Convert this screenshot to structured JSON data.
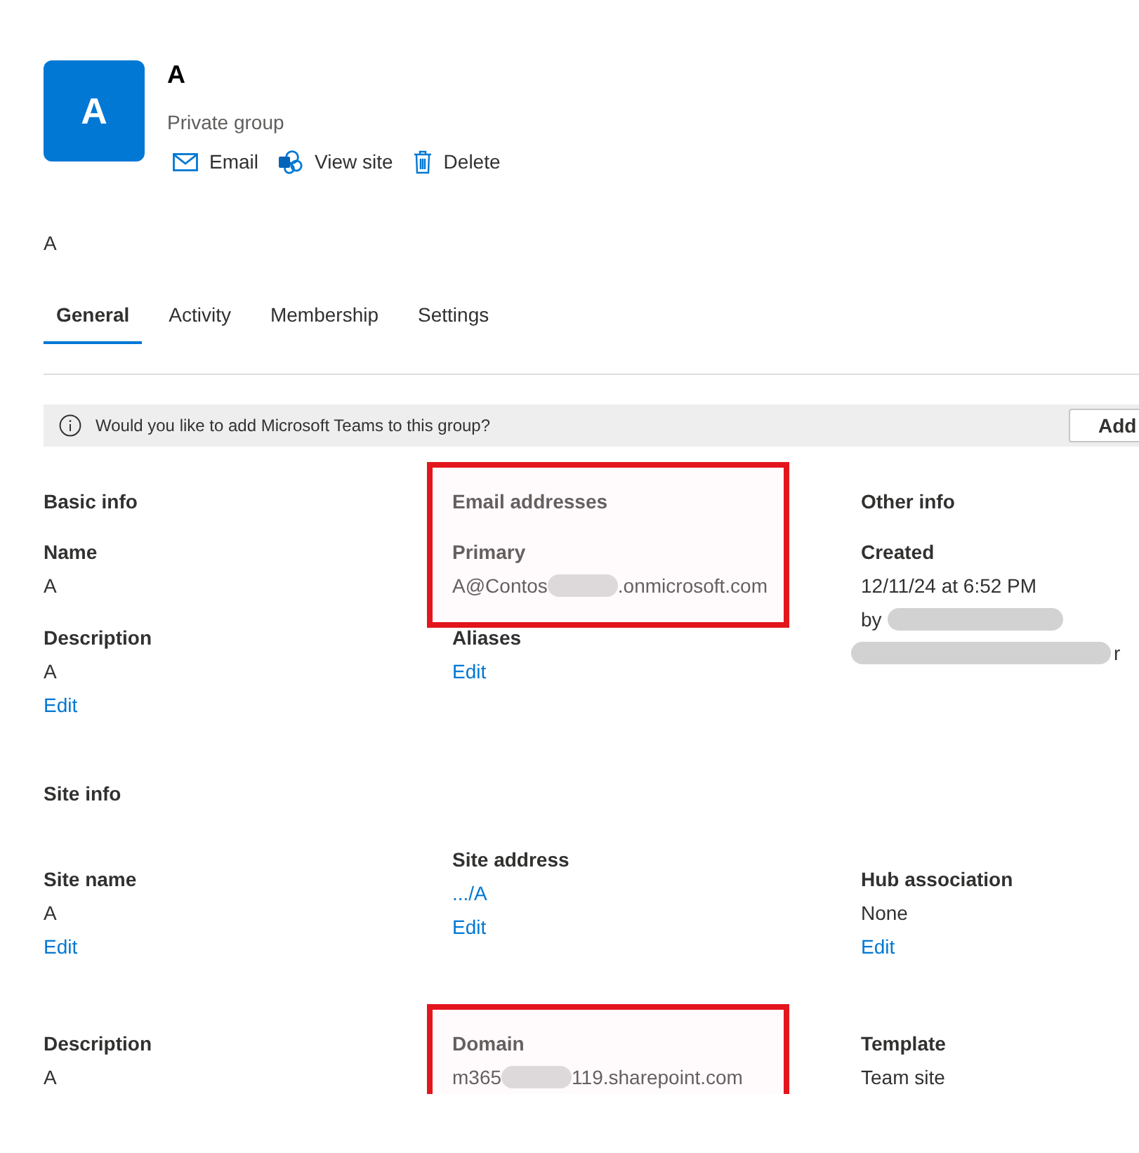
{
  "header": {
    "avatar": "A",
    "title": "A",
    "subtitle": "Private group",
    "actions": [
      {
        "label": "Email"
      },
      {
        "label": "View site"
      },
      {
        "label": "Delete"
      }
    ]
  },
  "description": "A",
  "tabs": [
    {
      "label": "General",
      "selected": true
    },
    {
      "label": "Activity",
      "selected": false
    },
    {
      "label": "Membership",
      "selected": false
    },
    {
      "label": "Settings",
      "selected": false
    }
  ],
  "banner": {
    "text": "Would you like to add Microsoft Teams to this group?",
    "button": "Add"
  },
  "blocks": [
    {
      "kind": "columns",
      "columns": [
        [
          {
            "kind": "heading",
            "text": "Basic info"
          },
          {
            "kind": "label",
            "text": "Name"
          },
          {
            "kind": "value",
            "parts": [
              {
                "kind": "text",
                "text": "A"
              }
            ]
          },
          {
            "kind": "label",
            "text": "Description"
          },
          {
            "kind": "value",
            "parts": [
              {
                "kind": "text",
                "text": "A"
              }
            ]
          },
          {
            "kind": "link",
            "text": "Edit"
          }
        ],
        [
          {
            "kind": "heading",
            "text": "Email addresses",
            "highlighted": true
          },
          {
            "kind": "label",
            "text": "Primary",
            "highlighted": true
          },
          {
            "kind": "value",
            "highlighted": true,
            "parts": [
              {
                "kind": "text",
                "text": "A@Contos"
              },
              {
                "kind": "redacted"
              },
              {
                "kind": "text",
                "text": ".onmicrosoft.com"
              }
            ]
          },
          {
            "kind": "label",
            "text": "Aliases"
          },
          {
            "kind": "link",
            "text": "Edit"
          }
        ],
        [
          {
            "kind": "heading",
            "text": "Other info"
          },
          {
            "kind": "label",
            "text": "Created"
          },
          {
            "kind": "value",
            "parts": [
              {
                "kind": "text",
                "text": "12/11/24 at 6:52 PM"
              }
            ]
          },
          {
            "kind": "value",
            "parts": [
              {
                "kind": "text",
                "text": "by"
              },
              {
                "kind": "redacted"
              }
            ]
          },
          {
            "kind": "value",
            "parts": [
              {
                "kind": "redacted"
              },
              {
                "kind": "text",
                "text": "r"
              }
            ]
          }
        ]
      ]
    },
    {
      "kind": "heading",
      "text": "Site info"
    },
    {
      "kind": "staggered",
      "columns": [
        [
          {
            "kind": "label",
            "text": "Site name"
          },
          {
            "kind": "value",
            "parts": [
              {
                "kind": "text",
                "text": "A"
              }
            ]
          },
          {
            "kind": "link",
            "text": "Edit"
          }
        ],
        [
          {
            "kind": "label",
            "text": "Site address"
          },
          {
            "kind": "link",
            "text": ".../A"
          },
          {
            "kind": "link",
            "text": "Edit"
          }
        ],
        [
          {
            "kind": "label",
            "text": "Hub association"
          },
          {
            "kind": "value",
            "parts": [
              {
                "kind": "text",
                "text": "None"
              }
            ]
          },
          {
            "kind": "link",
            "text": "Edit"
          }
        ]
      ]
    },
    {
      "kind": "columns",
      "columns": [
        [
          {
            "kind": "label",
            "text": "Description"
          },
          {
            "kind": "value",
            "parts": [
              {
                "kind": "text",
                "text": "A"
              }
            ]
          }
        ],
        [
          {
            "kind": "label",
            "text": "Domain",
            "highlighted": true
          },
          {
            "kind": "value",
            "highlighted": true,
            "parts": [
              {
                "kind": "text",
                "text": "m365"
              },
              {
                "kind": "redacted"
              },
              {
                "kind": "text",
                "text": "119.sharepoint.com"
              }
            ]
          }
        ],
        [
          {
            "kind": "label",
            "text": "Template"
          },
          {
            "kind": "value",
            "parts": [
              {
                "kind": "text",
                "text": "Team site"
              }
            ]
          }
        ]
      ]
    }
  ]
}
